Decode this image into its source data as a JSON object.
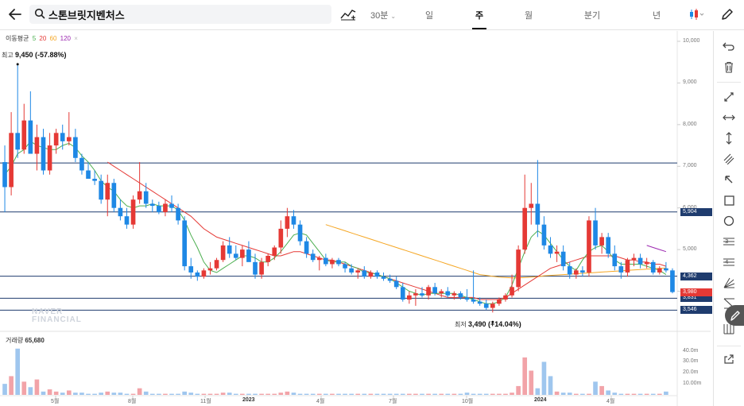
{
  "header": {
    "stock_name": "스톤브릿지벤처스",
    "interval_label": "30분",
    "periods": [
      {
        "label": "일",
        "active": false
      },
      {
        "label": "주",
        "active": true
      },
      {
        "label": "월",
        "active": false
      },
      {
        "label": "분기",
        "active": false
      },
      {
        "label": "년",
        "active": false
      }
    ],
    "icons": [
      "back-arrow-icon",
      "search-icon",
      "compare-chart-icon",
      "candlestick-type-icon",
      "pencil-icon"
    ]
  },
  "chart_data": {
    "type": "candlestick",
    "title": "",
    "ma_legend": {
      "label": "이동평균",
      "periods": [
        {
          "value": "5",
          "color": "#4caf50"
        },
        {
          "value": "20",
          "color": "#e53935"
        },
        {
          "value": "60",
          "color": "#f5a623"
        },
        {
          "value": "120",
          "color": "#9c27b0"
        }
      ]
    },
    "high_marker": {
      "label": "최고",
      "value": "9,450 (-57.88%)"
    },
    "low_marker": {
      "label": "최저",
      "value": "3,490 (+14.04%)"
    },
    "y_axis": {
      "ticks": [
        "10,000",
        "9,000",
        "8,000",
        "7,000",
        "6,000",
        "5,000",
        "4,000"
      ],
      "range": [
        3400,
        10200
      ]
    },
    "x_axis": {
      "ticks": [
        "5월",
        "8월",
        "11월",
        "2023",
        "4월",
        "7월",
        "10월",
        "2024",
        "4월"
      ],
      "bold_ticks": [
        "2023",
        "2024"
      ]
    },
    "horizontal_lines": [
      {
        "price": 7080,
        "label": ""
      },
      {
        "price": 5904,
        "label": "5,904"
      },
      {
        "price": 4362,
        "label": "4,362"
      },
      {
        "price": 3831,
        "label": "3,831"
      },
      {
        "price": 3546,
        "label": "3,546"
      }
    ],
    "current_price": {
      "label": "3,980",
      "color": "#e53935"
    },
    "candles": [
      {
        "o": 7100,
        "h": 7500,
        "l": 5900,
        "c": 6500
      },
      {
        "o": 6500,
        "h": 8300,
        "l": 6300,
        "c": 7800
      },
      {
        "o": 7800,
        "h": 9450,
        "l": 7200,
        "c": 7400
      },
      {
        "o": 7400,
        "h": 8500,
        "l": 7300,
        "c": 8100
      },
      {
        "o": 8100,
        "h": 8800,
        "l": 7600,
        "c": 7300
      },
      {
        "o": 7300,
        "h": 8000,
        "l": 6900,
        "c": 7700
      },
      {
        "o": 7700,
        "h": 7900,
        "l": 6800,
        "c": 6900
      },
      {
        "o": 6900,
        "h": 7800,
        "l": 6800,
        "c": 7500
      },
      {
        "o": 7500,
        "h": 7900,
        "l": 7300,
        "c": 7800
      },
      {
        "o": 7800,
        "h": 8000,
        "l": 7400,
        "c": 7600
      },
      {
        "o": 7600,
        "h": 8300,
        "l": 7500,
        "c": 7700
      },
      {
        "o": 7700,
        "h": 7900,
        "l": 7100,
        "c": 7200
      },
      {
        "o": 7200,
        "h": 7300,
        "l": 6800,
        "c": 6900
      },
      {
        "o": 6900,
        "h": 7100,
        "l": 6700,
        "c": 6700
      },
      {
        "o": 6700,
        "h": 6900,
        "l": 6550,
        "c": 6650
      },
      {
        "o": 6650,
        "h": 6800,
        "l": 6100,
        "c": 6200
      },
      {
        "o": 6200,
        "h": 6800,
        "l": 5800,
        "c": 6600
      },
      {
        "o": 6600,
        "h": 6700,
        "l": 5900,
        "c": 6000
      },
      {
        "o": 6000,
        "h": 6200,
        "l": 5700,
        "c": 5800
      },
      {
        "o": 5800,
        "h": 6000,
        "l": 5500,
        "c": 5600
      },
      {
        "o": 5600,
        "h": 6300,
        "l": 5500,
        "c": 6200
      },
      {
        "o": 6200,
        "h": 7100,
        "l": 6100,
        "c": 6400
      },
      {
        "o": 6400,
        "h": 6600,
        "l": 6000,
        "c": 6100
      },
      {
        "o": 6100,
        "h": 6200,
        "l": 5900,
        "c": 6050
      },
      {
        "o": 6050,
        "h": 6150,
        "l": 5850,
        "c": 5900
      },
      {
        "o": 5900,
        "h": 6200,
        "l": 5800,
        "c": 6100
      },
      {
        "o": 6100,
        "h": 6300,
        "l": 5900,
        "c": 6000
      },
      {
        "o": 6000,
        "h": 6100,
        "l": 5600,
        "c": 5700
      },
      {
        "o": 5700,
        "h": 5800,
        "l": 4500,
        "c": 4600
      },
      {
        "o": 4600,
        "h": 4800,
        "l": 4300,
        "c": 4450
      },
      {
        "o": 4450,
        "h": 4500,
        "l": 4250,
        "c": 4350
      },
      {
        "o": 4350,
        "h": 4550,
        "l": 4300,
        "c": 4500
      },
      {
        "o": 4500,
        "h": 4700,
        "l": 4400,
        "c": 4550
      },
      {
        "o": 4550,
        "h": 4800,
        "l": 4500,
        "c": 4750
      },
      {
        "o": 4750,
        "h": 5200,
        "l": 4700,
        "c": 5100
      },
      {
        "o": 5100,
        "h": 5300,
        "l": 4800,
        "c": 4900
      },
      {
        "o": 4900,
        "h": 5100,
        "l": 4750,
        "c": 4800
      },
      {
        "o": 4800,
        "h": 5100,
        "l": 4600,
        "c": 5000
      },
      {
        "o": 5000,
        "h": 5200,
        "l": 4800,
        "c": 4700
      },
      {
        "o": 4700,
        "h": 4900,
        "l": 4300,
        "c": 4400
      },
      {
        "o": 4400,
        "h": 4800,
        "l": 4300,
        "c": 4700
      },
      {
        "o": 4700,
        "h": 4900,
        "l": 4600,
        "c": 4850
      },
      {
        "o": 4850,
        "h": 5100,
        "l": 4750,
        "c": 5050
      },
      {
        "o": 5050,
        "h": 5700,
        "l": 4900,
        "c": 5500
      },
      {
        "o": 5500,
        "h": 6000,
        "l": 5300,
        "c": 5800
      },
      {
        "o": 5800,
        "h": 5950,
        "l": 5500,
        "c": 5600
      },
      {
        "o": 5600,
        "h": 5700,
        "l": 5100,
        "c": 5200
      },
      {
        "o": 5200,
        "h": 5300,
        "l": 4800,
        "c": 4900
      },
      {
        "o": 4900,
        "h": 5000,
        "l": 4700,
        "c": 4750
      },
      {
        "o": 4750,
        "h": 4850,
        "l": 4500,
        "c": 4800
      },
      {
        "o": 4800,
        "h": 4900,
        "l": 4600,
        "c": 4650
      },
      {
        "o": 4650,
        "h": 4800,
        "l": 4550,
        "c": 4750
      },
      {
        "o": 4750,
        "h": 4800,
        "l": 4600,
        "c": 4650
      },
      {
        "o": 4650,
        "h": 4700,
        "l": 4450,
        "c": 4550
      },
      {
        "o": 4550,
        "h": 4650,
        "l": 4400,
        "c": 4450
      },
      {
        "o": 4450,
        "h": 4550,
        "l": 4300,
        "c": 4500
      },
      {
        "o": 4500,
        "h": 4600,
        "l": 4300,
        "c": 4350
      },
      {
        "o": 4350,
        "h": 4500,
        "l": 4300,
        "c": 4450
      },
      {
        "o": 4450,
        "h": 4500,
        "l": 4300,
        "c": 4350
      },
      {
        "o": 4350,
        "h": 4450,
        "l": 4250,
        "c": 4300
      },
      {
        "o": 4300,
        "h": 4400,
        "l": 4200,
        "c": 4250
      },
      {
        "o": 4250,
        "h": 4350,
        "l": 4050,
        "c": 4100
      },
      {
        "o": 4100,
        "h": 4200,
        "l": 3750,
        "c": 3800
      },
      {
        "o": 3800,
        "h": 4000,
        "l": 3700,
        "c": 3900
      },
      {
        "o": 3900,
        "h": 4050,
        "l": 3650,
        "c": 3950
      },
      {
        "o": 3950,
        "h": 4100,
        "l": 3850,
        "c": 3900
      },
      {
        "o": 3900,
        "h": 4150,
        "l": 3800,
        "c": 4100
      },
      {
        "o": 4100,
        "h": 4200,
        "l": 3900,
        "c": 3950
      },
      {
        "o": 3950,
        "h": 4050,
        "l": 3850,
        "c": 4000
      },
      {
        "o": 4000,
        "h": 4100,
        "l": 3850,
        "c": 3900
      },
      {
        "o": 3900,
        "h": 4000,
        "l": 3800,
        "c": 3950
      },
      {
        "o": 3950,
        "h": 4000,
        "l": 3800,
        "c": 3850
      },
      {
        "o": 3850,
        "h": 4050,
        "l": 3750,
        "c": 3800
      },
      {
        "o": 3800,
        "h": 4500,
        "l": 3700,
        "c": 3750
      },
      {
        "o": 3750,
        "h": 3850,
        "l": 3650,
        "c": 3700
      },
      {
        "o": 3700,
        "h": 3800,
        "l": 3550,
        "c": 3600
      },
      {
        "o": 3600,
        "h": 3750,
        "l": 3490,
        "c": 3700
      },
      {
        "o": 3700,
        "h": 3850,
        "l": 3650,
        "c": 3800
      },
      {
        "o": 3800,
        "h": 3950,
        "l": 3750,
        "c": 3900
      },
      {
        "o": 3900,
        "h": 4400,
        "l": 3850,
        "c": 4100
      },
      {
        "o": 4100,
        "h": 5100,
        "l": 4000,
        "c": 5000
      },
      {
        "o": 5000,
        "h": 6800,
        "l": 4900,
        "c": 6000
      },
      {
        "o": 6000,
        "h": 6600,
        "l": 5600,
        "c": 6100
      },
      {
        "o": 6100,
        "h": 7150,
        "l": 5300,
        "c": 5600
      },
      {
        "o": 5600,
        "h": 5800,
        "l": 5000,
        "c": 5100
      },
      {
        "o": 5100,
        "h": 5300,
        "l": 4800,
        "c": 4900
      },
      {
        "o": 4900,
        "h": 5100,
        "l": 4700,
        "c": 4950
      },
      {
        "o": 4950,
        "h": 5100,
        "l": 4500,
        "c": 4600
      },
      {
        "o": 4600,
        "h": 4700,
        "l": 4300,
        "c": 4400
      },
      {
        "o": 4400,
        "h": 4550,
        "l": 4300,
        "c": 4500
      },
      {
        "o": 4500,
        "h": 4600,
        "l": 4350,
        "c": 4450
      },
      {
        "o": 4450,
        "h": 5800,
        "l": 4350,
        "c": 5700
      },
      {
        "o": 5700,
        "h": 6000,
        "l": 5000,
        "c": 5100
      },
      {
        "o": 5100,
        "h": 5400,
        "l": 4900,
        "c": 5300
      },
      {
        "o": 5300,
        "h": 5400,
        "l": 4800,
        "c": 4900
      },
      {
        "o": 4900,
        "h": 5100,
        "l": 4500,
        "c": 4600
      },
      {
        "o": 4600,
        "h": 4700,
        "l": 4300,
        "c": 4450
      },
      {
        "o": 4450,
        "h": 4800,
        "l": 4350,
        "c": 4750
      },
      {
        "o": 4750,
        "h": 4900,
        "l": 4600,
        "c": 4800
      },
      {
        "o": 4800,
        "h": 4900,
        "l": 4550,
        "c": 4650
      },
      {
        "o": 4650,
        "h": 4800,
        "l": 4550,
        "c": 4700
      },
      {
        "o": 4700,
        "h": 4750,
        "l": 4400,
        "c": 4450
      },
      {
        "o": 4450,
        "h": 4600,
        "l": 4400,
        "c": 4550
      },
      {
        "o": 4550,
        "h": 4700,
        "l": 4450,
        "c": 4500
      },
      {
        "o": 4500,
        "h": 4550,
        "l": 3950,
        "c": 3980
      }
    ],
    "ma5": [
      6800,
      7000,
      7300,
      7400,
      7600,
      7500,
      7450,
      7400,
      7400,
      7500,
      7550,
      7450,
      7250,
      7100,
      6900,
      6650,
      6500,
      6400,
      6200,
      6050,
      6000,
      6050,
      6050,
      6100,
      6050,
      6050,
      6050,
      5950,
      5700,
      5350,
      5050,
      4700,
      4500,
      4450,
      4550,
      4650,
      4750,
      4850,
      4850,
      4800,
      4700,
      4700,
      4800,
      4950,
      5150,
      5350,
      5400,
      5350,
      5150,
      4950,
      4750,
      4700,
      4700,
      4700,
      4600,
      4550,
      4450,
      4450,
      4400,
      4350,
      4300,
      4200,
      4100,
      4000,
      3950,
      3900,
      3950,
      3950,
      3950,
      3950,
      3950,
      3900,
      3850,
      3800,
      3750,
      3700,
      3700,
      3750,
      3850,
      4150,
      4550,
      4950,
      5300,
      5450,
      5350,
      5150,
      4950,
      4750,
      4600,
      4500,
      4750,
      4950,
      5050,
      5100,
      4950,
      4750,
      4650,
      4650,
      4650,
      4650,
      4600,
      4550,
      4500,
      4400
    ],
    "ma20": [
      null,
      null,
      null,
      null,
      null,
      null,
      null,
      null,
      null,
      null,
      null,
      null,
      null,
      null,
      null,
      null,
      7100,
      7000,
      6900,
      6800,
      6700,
      6600,
      6500,
      6400,
      6300,
      6200,
      6100,
      6000,
      5900,
      5800,
      5650,
      5500,
      5400,
      5300,
      5250,
      5200,
      5150,
      5100,
      5050,
      5000,
      4950,
      4900,
      4850,
      4850,
      4900,
      4950,
      4950,
      4900,
      4850,
      4800,
      4750,
      4750,
      4700,
      4650,
      4600,
      4550,
      4500,
      4450,
      4400,
      4350,
      4300,
      4250,
      4200,
      4150,
      4100,
      4050,
      4000,
      3950,
      3900,
      3850,
      3850,
      3850,
      3850,
      3850,
      3800,
      3800,
      3800,
      3800,
      3850,
      3950,
      4050,
      4150,
      4250,
      4350,
      4450,
      4550,
      4600,
      4650,
      4700,
      4750,
      4800,
      4850,
      4850,
      4850,
      4850,
      4850,
      4800,
      4750,
      4750,
      4700,
      4700,
      4650,
      4650,
      4600
    ],
    "ma60": [
      null,
      null,
      null,
      null,
      null,
      null,
      null,
      null,
      null,
      null,
      null,
      null,
      null,
      null,
      null,
      null,
      null,
      null,
      null,
      null,
      null,
      null,
      null,
      null,
      null,
      null,
      null,
      null,
      null,
      null,
      null,
      null,
      null,
      null,
      null,
      null,
      null,
      null,
      null,
      null,
      null,
      null,
      null,
      null,
      null,
      null,
      null,
      null,
      null,
      null,
      5600,
      5550,
      5500,
      5450,
      5400,
      5350,
      5300,
      5250,
      5200,
      5150,
      5100,
      5050,
      5000,
      4950,
      4900,
      4850,
      4800,
      4750,
      4700,
      4650,
      4600,
      4550,
      4500,
      4450,
      4400,
      4380,
      4360,
      4340,
      4330,
      4320,
      4320,
      4330,
      4340,
      4350,
      4370,
      4380,
      4390,
      4400,
      4410,
      4420,
      4430,
      4440,
      4450,
      4460,
      4470,
      4480,
      4490,
      4500,
      4510,
      4520,
      4530,
      4540,
      4550,
      4560
    ],
    "ma120": [
      null,
      null,
      null,
      null,
      null,
      null,
      null,
      null,
      null,
      null,
      null,
      null,
      null,
      null,
      null,
      null,
      null,
      null,
      null,
      null,
      null,
      null,
      null,
      null,
      null,
      null,
      null,
      null,
      null,
      null,
      null,
      null,
      null,
      null,
      null,
      null,
      null,
      null,
      null,
      null,
      null,
      null,
      null,
      null,
      null,
      null,
      null,
      null,
      null,
      null,
      null,
      null,
      null,
      null,
      null,
      null,
      null,
      null,
      null,
      null,
      null,
      null,
      null,
      null,
      null,
      null,
      null,
      null,
      null,
      null,
      null,
      null,
      null,
      null,
      null,
      null,
      null,
      null,
      null,
      null,
      null,
      null,
      null,
      null,
      null,
      null,
      null,
      null,
      null,
      null,
      null,
      null,
      null,
      null,
      null,
      null,
      null,
      null,
      null,
      null,
      5100,
      5050,
      5000,
      4950
    ],
    "volume": {
      "label": "거래량",
      "value": "65,680",
      "y_ticks": [
        "40.0m",
        "30.0m",
        "20.0m",
        "10.00m"
      ],
      "values": [
        10,
        17,
        42,
        12,
        7,
        14,
        3,
        5,
        3,
        2,
        4,
        2,
        2,
        1,
        1,
        2,
        3,
        2,
        2,
        1,
        1,
        6,
        3,
        1,
        1,
        1,
        1,
        1,
        3,
        2,
        1,
        1,
        1,
        1,
        2,
        2,
        1,
        1,
        1,
        1,
        1,
        1,
        1,
        2,
        3,
        2,
        1,
        1,
        1,
        1,
        1,
        1,
        1,
        1,
        1,
        1,
        1,
        1,
        1,
        1,
        1,
        1,
        1,
        1,
        1,
        1,
        1,
        1,
        1,
        1,
        1,
        1,
        2,
        1,
        1,
        1,
        1,
        1,
        1,
        2,
        8,
        34,
        22,
        6,
        30,
        17,
        3,
        2,
        2,
        1,
        1,
        1,
        12,
        8,
        4,
        2,
        1,
        1,
        1,
        1,
        1,
        1,
        1,
        3
      ]
    }
  },
  "watermark": [
    "NAVER",
    "FINANCIAL"
  ],
  "right_toolbar": [
    "undo-icon",
    "trash-icon",
    "trendline-icon",
    "horizontal-line-icon",
    "vertical-line-icon",
    "parallel-channel-icon",
    "arrow-icon",
    "rectangle-icon",
    "circle-icon",
    "fibonacci-icon",
    "fibonacci-fan-icon",
    "gann-fan-icon",
    "pitchfork-icon",
    "grid-icon",
    "share-icon"
  ]
}
